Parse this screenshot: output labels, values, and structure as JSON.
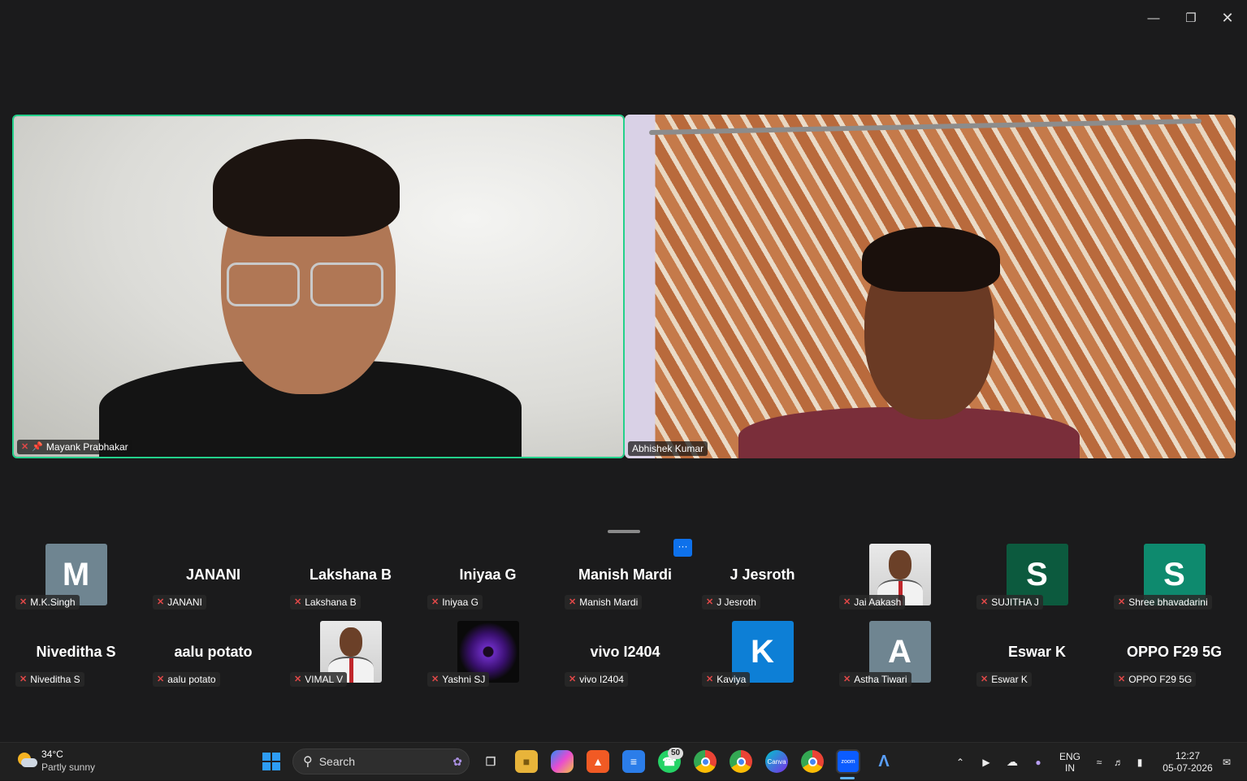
{
  "window": {
    "minimize_icon": "minimize-icon",
    "restore_icon": "restore-icon",
    "close_icon": "close-icon"
  },
  "speakers": [
    {
      "name": "Mayank Prabhakar",
      "muted": true,
      "pinned": true,
      "active_speaker": true
    },
    {
      "name": "Abhishek Kumar",
      "muted": false
    }
  ],
  "more_button": "···",
  "gallery": [
    {
      "display": "M",
      "name": "M.K.Singh",
      "type": "avatar",
      "color": "#6f8591"
    },
    {
      "display": "JANANI",
      "name": "JANANI",
      "type": "text"
    },
    {
      "display": "Lakshana B",
      "name": "Lakshana B",
      "type": "text"
    },
    {
      "display": "Iniyaa G",
      "name": "Iniyaa G",
      "type": "text"
    },
    {
      "display": "Manish Mardi",
      "name": "Manish Mardi",
      "type": "text"
    },
    {
      "display": "J Jesroth",
      "name": "J Jesroth",
      "type": "text"
    },
    {
      "display": "",
      "name": "Jai Aakash",
      "type": "photo"
    },
    {
      "display": "S",
      "name": "SUJITHA J",
      "type": "avatar",
      "color": "#0c5a3e"
    },
    {
      "display": "S",
      "name": "Shree bhavadarini",
      "type": "avatar",
      "color": "#0e8a6e"
    },
    {
      "display": "Niveditha S",
      "name": "Niveditha S",
      "type": "text"
    },
    {
      "display": "aalu potato",
      "name": "aalu potato",
      "type": "text"
    },
    {
      "display": "",
      "name": "VIMAL V",
      "type": "photo"
    },
    {
      "display": "",
      "name": "Yashni SJ",
      "type": "flower"
    },
    {
      "display": "vivo I2404",
      "name": "vivo I2404",
      "type": "text"
    },
    {
      "display": "K",
      "name": "Kaviya",
      "type": "avatar",
      "color": "#0d7fd6"
    },
    {
      "display": "A",
      "name": "Astha Tiwari",
      "type": "avatar",
      "color": "#6f8591"
    },
    {
      "display": "Eswar K",
      "name": "Eswar K",
      "type": "text"
    },
    {
      "display": "OPPO F29 5G",
      "name": "OPPO F29 5G",
      "type": "text"
    }
  ],
  "taskbar": {
    "weather_temp": "34°C",
    "weather_desc": "Partly sunny",
    "search_label": "Search",
    "whatsapp_badge": "50",
    "lang_top": "ENG",
    "lang_bottom": "IN",
    "time": "12:27",
    "date": "05-07-2026"
  }
}
